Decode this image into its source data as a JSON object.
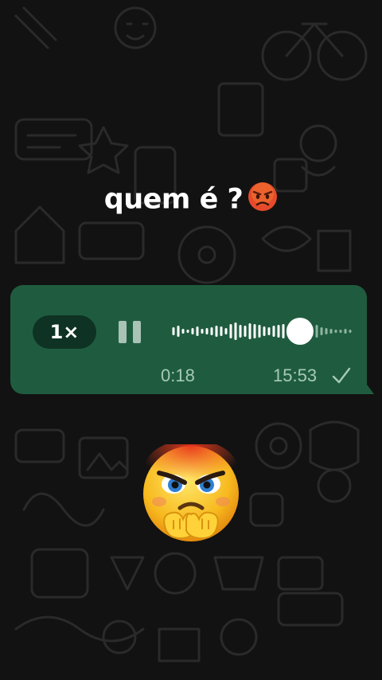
{
  "caption": {
    "text": "quem é ?",
    "emoji_icon": "angry-face-icon"
  },
  "voice_message": {
    "speed_label": "1×",
    "control_icon": "pause-icon",
    "duration": "0:18",
    "timestamp": "15:53",
    "status_icon": "single-check-icon",
    "progress": 0.71,
    "bubble_color": "#1f5c3f",
    "chip_color": "#0e3224"
  },
  "sticker": {
    "icon": "angry-emoji-sticker-icon"
  }
}
